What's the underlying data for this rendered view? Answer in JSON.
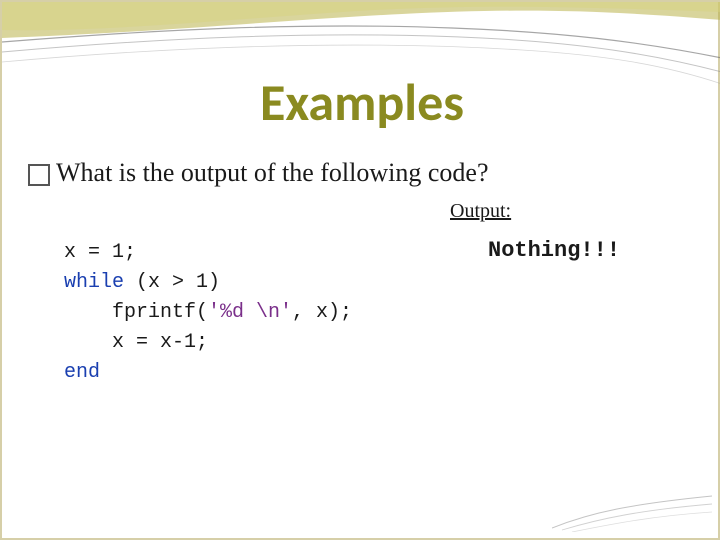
{
  "title": "Examples",
  "question": "What is the output of the following code?",
  "output_label": "Output:",
  "output_value": "Nothing!!!",
  "code": {
    "l1a": "x = 1;",
    "l2_kw": "while",
    "l2_rest": " (x > 1)",
    "l3a": "    fprintf(",
    "l3_str": "'%d \\n'",
    "l3b": ", x);",
    "l4": "    x = x-1;",
    "l5_kw": "end"
  }
}
